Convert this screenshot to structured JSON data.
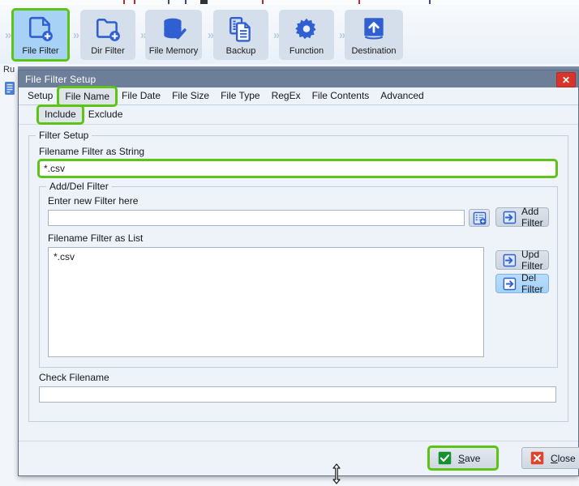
{
  "background": {
    "run_label": "Ru",
    "bg_icon_name": "document-list-icon"
  },
  "toolbar": {
    "items": [
      {
        "label": "File Filter",
        "icon": "file-add-icon",
        "active": true
      },
      {
        "label": "Dir Filter",
        "icon": "folder-add-icon",
        "active": false
      },
      {
        "label": "File Memory",
        "icon": "database-check-icon",
        "active": false
      },
      {
        "label": "Backup",
        "icon": "copy-documents-icon",
        "active": false
      },
      {
        "label": "Function",
        "icon": "gear-icon",
        "active": false
      },
      {
        "label": "Destination",
        "icon": "upload-arrow-icon",
        "active": false
      }
    ],
    "separator_glyph": "»"
  },
  "dialog": {
    "title": "File Filter Setup",
    "close_icon": "close-icon",
    "close_glyph": "✕",
    "tabs": [
      {
        "label": "Setup",
        "selected": false
      },
      {
        "label": "File Name",
        "selected": true
      },
      {
        "label": "File Date",
        "selected": false
      },
      {
        "label": "File Size",
        "selected": false
      },
      {
        "label": "File Type",
        "selected": false
      },
      {
        "label": "RegEx",
        "selected": false
      },
      {
        "label": "File Contents",
        "selected": false
      },
      {
        "label": "Advanced",
        "selected": false
      }
    ],
    "subtabs": [
      {
        "label": "Include",
        "selected": true
      },
      {
        "label": "Exclude",
        "selected": false
      }
    ],
    "filter_setup": {
      "legend": "Filter Setup",
      "filename_filter_as_string_label": "Filename Filter as String",
      "filename_filter_as_string_value": "*.csv",
      "add_del_filter": {
        "legend": "Add/Del Filter",
        "enter_new_filter_label": "Enter new Filter here",
        "enter_new_filter_value": "",
        "picker_icon": "list-add-icon",
        "filename_filter_as_list_label": "Filename Filter as List",
        "list_items": [
          "*.csv"
        ],
        "buttons": [
          {
            "label": "Add Filter",
            "icon": "arrow-into-box-icon",
            "highlighted": false
          },
          {
            "label": "Upd Filter",
            "icon": "arrow-into-box-icon",
            "highlighted": false
          },
          {
            "label": "Del Filter",
            "icon": "arrow-out-of-box-icon",
            "highlighted": true
          }
        ]
      },
      "check_filename_label": "Check Filename",
      "check_filename_value": ""
    },
    "footer": {
      "save": {
        "label_pre": "",
        "accel": "S",
        "label_post": "ave",
        "icon": "green-check-icon"
      },
      "close": {
        "label_pre": "",
        "accel": "C",
        "label_post": "lose",
        "icon": "red-x-icon"
      }
    }
  },
  "cursor": {
    "name": "resize-vertical-cursor"
  },
  "colors": {
    "highlight_green": "#5cc414",
    "titlebar": "#6c7e98",
    "dialog_bg": "#eef2f9",
    "accent_blue": "#2f5fd0",
    "close_red": "#d9342b",
    "save_green": "#13932f"
  }
}
